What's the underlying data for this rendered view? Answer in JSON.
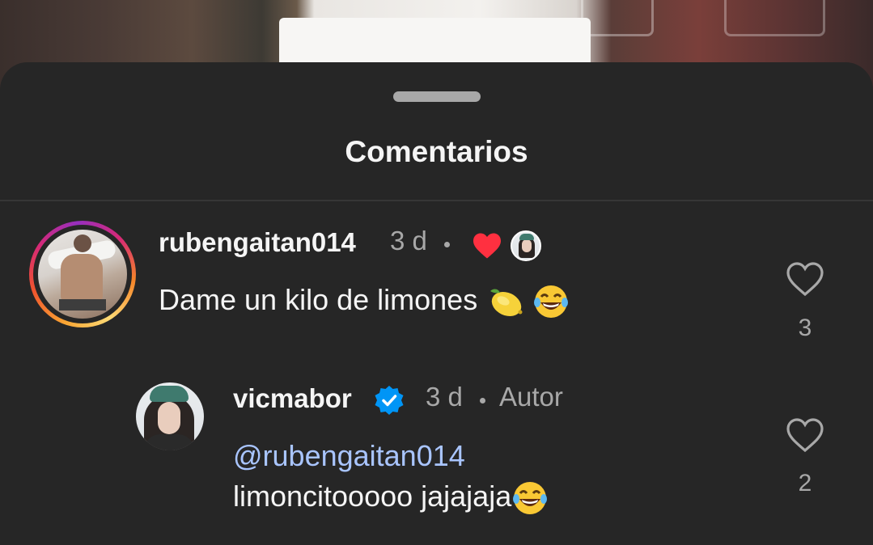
{
  "sheet": {
    "title": "Comentarios"
  },
  "comments": [
    {
      "username": "rubengaitan014",
      "time": "3 d",
      "text": "Dame un kilo de limones",
      "like_count": "3",
      "emojis": [
        "lemon-emoji",
        "laughing-emoji"
      ],
      "liked_by_author": true
    },
    {
      "username": "vicmabor",
      "verified": true,
      "time": "3 d",
      "author_label": "Autor",
      "mention": "@rubengaitan014",
      "text_line2": "limoncitooooo jajajaja",
      "like_count": "2",
      "emojis": [
        "laughing-emoji"
      ]
    }
  ],
  "colors": {
    "background": "#262626",
    "heart_red": "#ff3040",
    "verified_blue": "#0095f6",
    "mention_blue": "#a9c5ff",
    "secondary_text": "#a8a8a8"
  }
}
